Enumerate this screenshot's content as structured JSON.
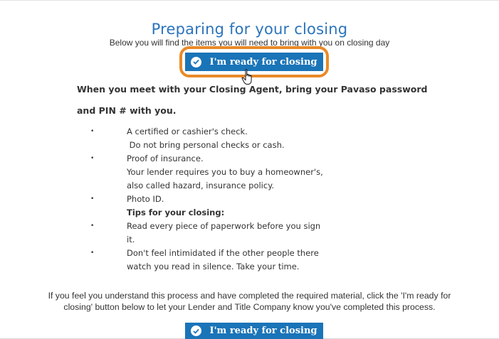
{
  "header": {
    "title": "Preparing for your closing",
    "subtitle": "Below you will find the items you will need to bring with you on closing day"
  },
  "ready_button": {
    "label": "I'm ready for closing"
  },
  "intro": {
    "line1": "When you meet with your Closing Agent, bring your Pavaso password",
    "line2": "and PIN # with you."
  },
  "checklist": {
    "bullet": "•",
    "items": [
      "A certified or cashier's check.",
      " Do not bring personal checks or cash.",
      "Proof of insurance.",
      "Your lender requires you to buy a homeowner's,",
      "also called hazard, insurance policy.",
      "Photo ID.",
      "Tips for your closing:",
      "Read every piece of paperwork before you sign",
      "it.",
      "Don't feel intimidated if the other people there",
      "watch you read in silence. Take your time."
    ]
  },
  "closing_note": {
    "line1": "If you feel you understand this process and have completed the required material, click the 'I'm ready for",
    "line2": "closing' button below to let your Lender and Title Company know you've completed this process."
  },
  "colors": {
    "title": "#2b74bc",
    "button": "#1a74b8",
    "highlight": "#e98a29"
  },
  "icons": {
    "button_icon": "check-circle-icon",
    "cursor": "hand-pointer-icon"
  }
}
